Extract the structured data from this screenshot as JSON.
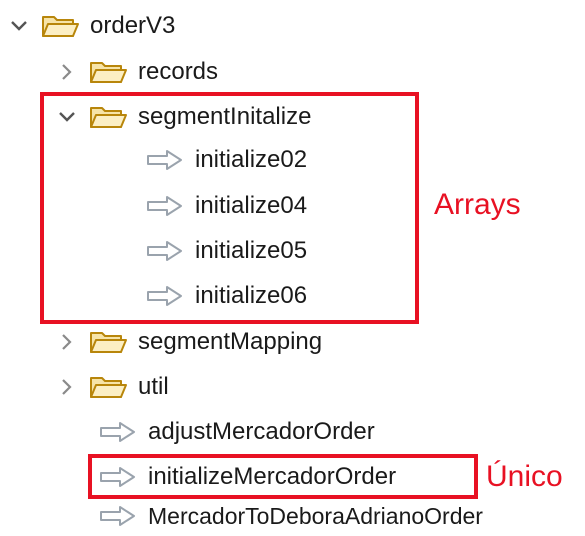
{
  "tree": {
    "root": {
      "label": "orderV3",
      "expanded": true,
      "icon": "folder-icon"
    },
    "records": {
      "label": "records",
      "expanded": false,
      "icon": "folder-icon"
    },
    "segment_initialize": {
      "label": "segmentInitalize",
      "expanded": true,
      "icon": "folder-icon",
      "children": [
        {
          "label": "initialize02",
          "icon": "arrow-file-icon"
        },
        {
          "label": "initialize04",
          "icon": "arrow-file-icon"
        },
        {
          "label": "initialize05",
          "icon": "arrow-file-icon"
        },
        {
          "label": "initialize06",
          "icon": "arrow-file-icon"
        }
      ]
    },
    "segment_mapping": {
      "label": "segmentMapping",
      "expanded": false,
      "icon": "folder-icon"
    },
    "util": {
      "label": "util",
      "expanded": false,
      "icon": "folder-icon"
    },
    "files": [
      {
        "label": "adjustMercadorOrder",
        "icon": "arrow-file-icon"
      },
      {
        "label": "initializeMercadorOrder",
        "icon": "arrow-file-icon"
      },
      {
        "label": "MercadorToDeboraAdrianoOrder",
        "icon": "arrow-file-icon"
      }
    ]
  },
  "annotations": {
    "arrays_label": "Arrays",
    "unico_label": "Único",
    "highlight_color": "#e81123"
  },
  "colors": {
    "folder_stroke": "#b8860b",
    "folder_fill": "#f7e4a8",
    "arrow_stroke": "#9aa3ad",
    "twisty": "#555555"
  }
}
